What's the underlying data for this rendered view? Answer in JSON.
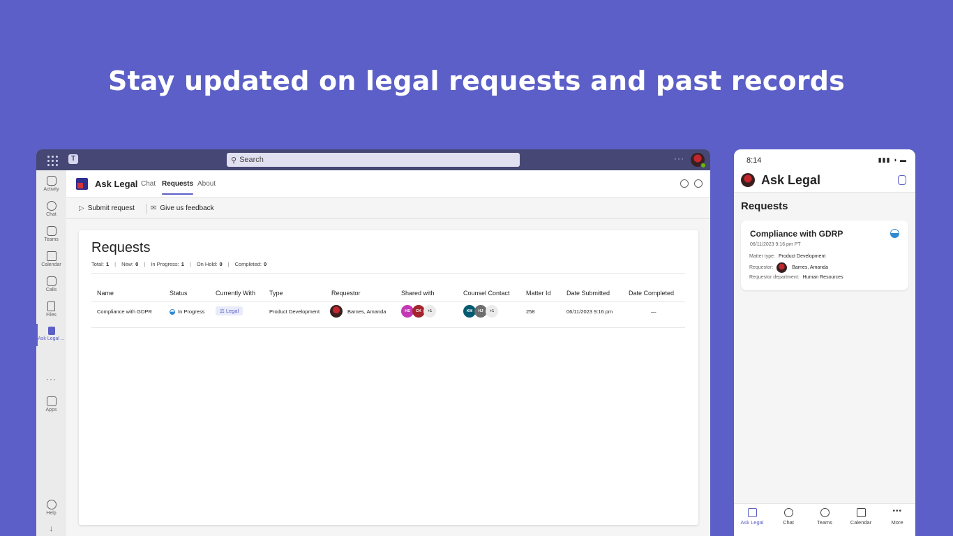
{
  "headline": "Stay updated on legal requests and past records",
  "desktop": {
    "search_placeholder": "Search",
    "more_glyph": "···",
    "rail": [
      {
        "label": "Activity"
      },
      {
        "label": "Chat"
      },
      {
        "label": "Teams"
      },
      {
        "label": "Calendar"
      },
      {
        "label": "Calls"
      },
      {
        "label": "Files"
      },
      {
        "label": "Ask Legal ..."
      },
      {
        "label": "Apps"
      },
      {
        "label": "Help"
      }
    ],
    "rail_more": "···",
    "app_name": "Ask Legal",
    "tabs": [
      "Chat",
      "Requests",
      "About"
    ],
    "active_tab": "Requests",
    "toolbar": {
      "submit": "Submit request",
      "feedback": "Give us feedback"
    },
    "card_title": "Requests",
    "stats": [
      {
        "label": "Total:",
        "value": "1"
      },
      {
        "label": "New:",
        "value": "0"
      },
      {
        "label": "In Progress:",
        "value": "1"
      },
      {
        "label": "On Hold:",
        "value": "0"
      },
      {
        "label": "Completed:",
        "value": "0"
      }
    ],
    "columns": [
      "Name",
      "Status",
      "Currently With",
      "Type",
      "Requestor",
      "Shared with",
      "Counsel Contact",
      "Matter Id",
      "Date Submitted",
      "Date Completed"
    ],
    "row": {
      "name": "Compliance with GDPR",
      "status": "In Progress",
      "currently_with": "Legal",
      "type": "Product Development",
      "requestor": "Barnes, Amanda",
      "shared_with": [
        "HS",
        "CK",
        "+1"
      ],
      "counsel_contact": [
        "KM",
        "HJ",
        "+1"
      ],
      "matter_id": "258",
      "date_submitted": "06/11/2023 9:16 pm",
      "date_completed": "—"
    }
  },
  "phone": {
    "time": "8:14",
    "app_name": "Ask Legal",
    "section": "Requests",
    "card": {
      "title": "Compliance with GDRP",
      "date": "06/11/2023 9:16 pm PT",
      "matter_type_label": "Matter type:",
      "matter_type": "Product Development",
      "requestor_label": "Requestor:",
      "requestor": "Barnes, Amanda",
      "department_label": "Requestor department:",
      "department": "Human Resources"
    },
    "nav": [
      "Ask Legal",
      "Chat",
      "Teams",
      "Calendar",
      "More"
    ],
    "active_nav": "Ask Legal"
  },
  "colors": {
    "background": "#5b5fc7",
    "titlebar": "#464775",
    "accent": "#5b5fc7"
  }
}
